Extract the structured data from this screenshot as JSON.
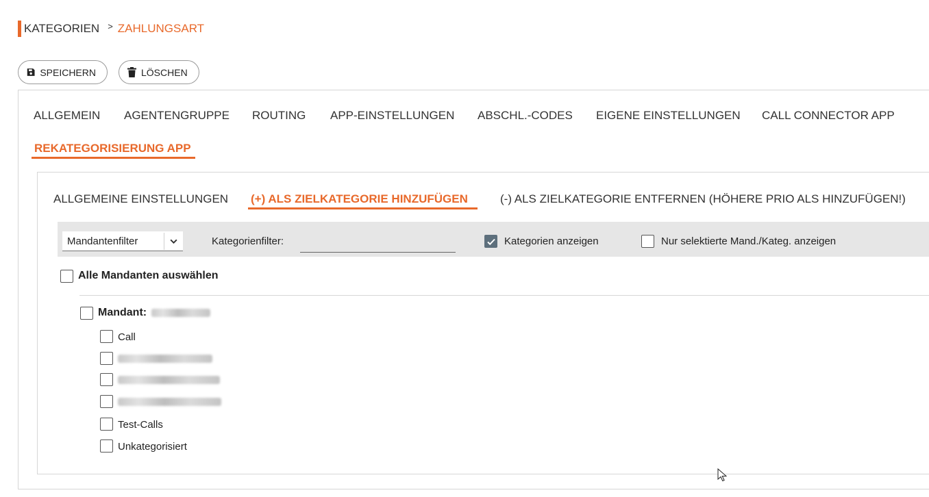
{
  "breadcrumb": {
    "parent": "KATEGORIEN",
    "separator": ">",
    "current": "ZAHLUNGSART"
  },
  "toolbar": {
    "save_label": "SPEICHERN",
    "delete_label": "LÖSCHEN"
  },
  "tabs": [
    {
      "label": "ALLGEMEIN"
    },
    {
      "label": "AGENTENGRUPPE"
    },
    {
      "label": "ROUTING"
    },
    {
      "label": "APP-EINSTELLUNGEN"
    },
    {
      "label": "ABSCHL.-CODES"
    },
    {
      "label": "EIGENE EINSTELLUNGEN"
    },
    {
      "label": "CALL CONNECTOR APP"
    },
    {
      "label": "REKATEGORISIERUNG APP",
      "active": true
    }
  ],
  "subtabs": [
    {
      "label": "ALLGEMEINE EINSTELLUNGEN"
    },
    {
      "label": "(+) ALS ZIELKATEGORIE HINZUFÜGEN",
      "active": true
    },
    {
      "label": "(-) ALS ZIELKATEGORIE ENTFERNEN (HÖHERE PRIO ALS HINZUFÜGEN!)"
    }
  ],
  "filters": {
    "mandant_select_value": "Mandantenfilter",
    "category_filter_label": "Kategorienfilter:",
    "category_filter_value": "",
    "show_categories_label": "Kategorien anzeigen",
    "show_categories_checked": true,
    "only_selected_label": "Nur selektierte Mand./Kateg. anzeigen",
    "only_selected_checked": false
  },
  "tree": {
    "select_all_label": "Alle Mandanten auswählen",
    "mandant_label": "Mandant:",
    "categories": [
      {
        "label": "Call",
        "checked": false
      },
      {
        "label": "",
        "blurred": true,
        "checked": false
      },
      {
        "label": "",
        "blurred": true,
        "checked": false
      },
      {
        "label": "",
        "blurred": true,
        "checked": false
      },
      {
        "label": "Test-Calls",
        "checked": false
      },
      {
        "label": "Unkategorisiert",
        "checked": false
      }
    ]
  },
  "colors": {
    "accent": "#e8692b",
    "filterbar": "#e6e6e6",
    "checkbox_checked": "#5d6f7c"
  }
}
